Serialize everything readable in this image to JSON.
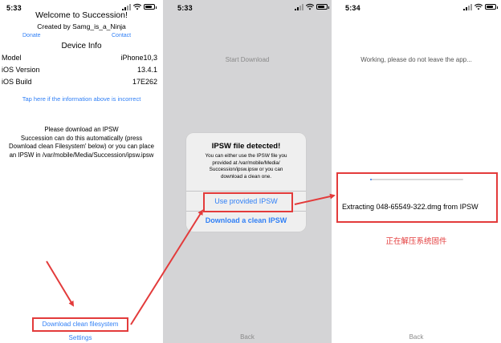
{
  "panel1": {
    "status_time": "5:33",
    "title": "Welcome to Succession!",
    "subtitle": "Created by Samg_is_a_Ninja",
    "donate": "Donate",
    "contact": "Contact",
    "section_title": "Device Info",
    "info": [
      {
        "label": "Model",
        "value": "iPhone10,3"
      },
      {
        "label": "iOS Version",
        "value": "13.4.1"
      },
      {
        "label": "iOS Build",
        "value": "17E262"
      }
    ],
    "incorrect_link": "Tap here if the information above is incorrect",
    "instructions": [
      "Please download an IPSW",
      "Succession can do this automatically (press",
      "Download clean Filesystem' below) or you can place",
      "an IPSW in /var/mobile/Media/Succession/ipsw.ipsw"
    ],
    "download_button": "Download clean filesystem",
    "settings_button": "Settings"
  },
  "panel2": {
    "status_time": "5:33",
    "start_download": "Start Download",
    "back_button": "Back",
    "alert": {
      "title": "IPSW file detected!",
      "message": [
        "You can either use the IPSW file you",
        "provided at /var/mobile/Media/",
        "Succession/ipsw.ipsw or you can",
        "download a clean one."
      ],
      "use_provided": "Use provided IPSW",
      "download_clean": "Download a clean IPSW"
    }
  },
  "panel3": {
    "status_time": "5:34",
    "working_text": "Working, please do not leave the app...",
    "progress": 0.02,
    "extracting_text": "Extracting 048-65549-322.dmg from IPSW",
    "chinese_caption": "正在解压系统固件",
    "back_button": "Back"
  },
  "colors": {
    "link_blue": "#2f7ff6",
    "annotation_red": "#e33b3b",
    "panel2_background": "#d4d4d6"
  }
}
